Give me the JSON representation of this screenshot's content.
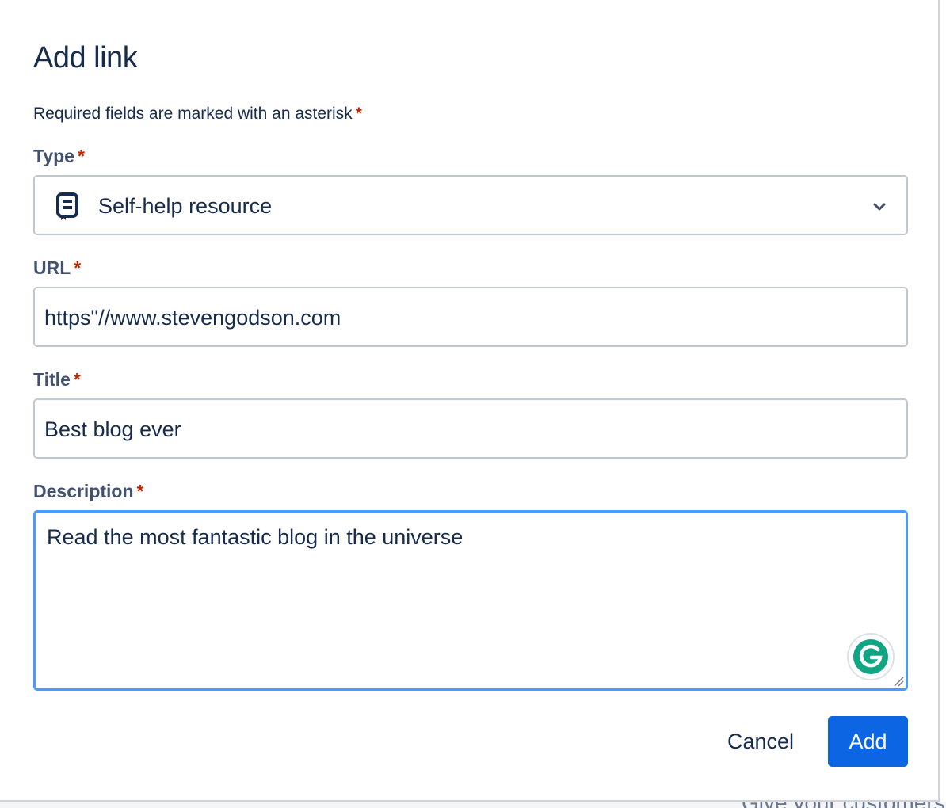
{
  "dialog": {
    "title": "Add link",
    "required_note": "Required fields are marked with an asterisk",
    "asterisk": "*"
  },
  "fields": {
    "type": {
      "label": "Type",
      "value": "Self-help resource",
      "icon": "book-icon"
    },
    "url": {
      "label": "URL",
      "value": "https\"//www.stevengodson.com"
    },
    "title": {
      "label": "Title",
      "value": "Best blog ever"
    },
    "description": {
      "label": "Description",
      "value": "Read the most fantastic blog in the universe"
    }
  },
  "buttons": {
    "cancel": "Cancel",
    "add": "Add"
  },
  "background": {
    "text": "Give your customers and team access to external knowledge and tools"
  },
  "colors": {
    "primary": "#0c66e4",
    "required": "#bf2600",
    "focus": "#4c9aff",
    "text": "#172b4d",
    "label": "#42526e",
    "grammarly": "#15c39a"
  }
}
